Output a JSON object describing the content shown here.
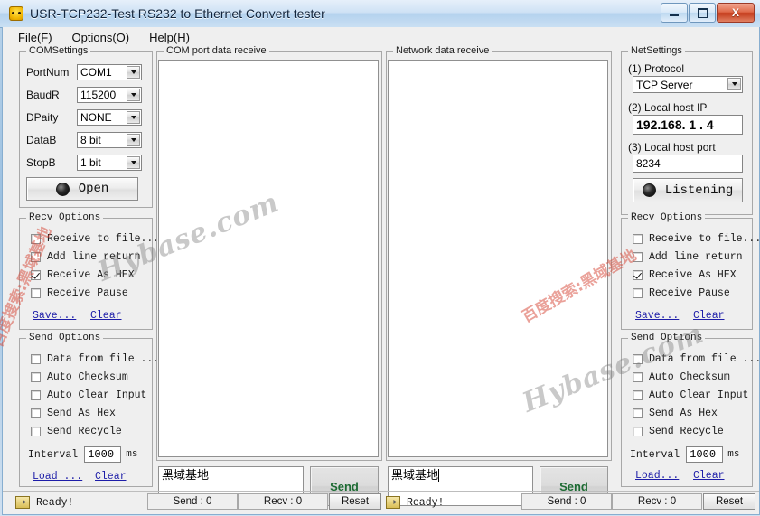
{
  "window": {
    "title": "USR-TCP232-Test  RS232 to Ethernet Convert tester",
    "icon": "app-icon",
    "minimize_label": "Minimize",
    "maximize_label": "Maximize",
    "close_label": "X"
  },
  "menu": [
    {
      "label": "File(F)",
      "name": "menu-file"
    },
    {
      "label": "Options(O)",
      "name": "menu-options"
    },
    {
      "label": "Help(H)",
      "name": "menu-help"
    }
  ],
  "com_settings": {
    "legend": "COMSettings",
    "fields": [
      {
        "label": "PortNum",
        "value": "COM1"
      },
      {
        "label": "BaudR",
        "value": "115200"
      },
      {
        "label": "DPaity",
        "value": "NONE"
      },
      {
        "label": "DataB",
        "value": "8 bit"
      },
      {
        "label": "StopB",
        "value": "1 bit"
      }
    ],
    "open_button": "Open"
  },
  "com_recv_options": {
    "legend": "Recv Options",
    "items": [
      {
        "label": "Receive to file...",
        "checked": false
      },
      {
        "label": "Add line return",
        "checked": false
      },
      {
        "label": "Receive As HEX",
        "checked": true
      },
      {
        "label": "Receive Pause",
        "checked": false
      }
    ],
    "save_link": "Save...",
    "clear_link": "Clear"
  },
  "com_send_options": {
    "legend": "Send Options",
    "items": [
      {
        "label": "Data from file ...",
        "checked": false
      },
      {
        "label": "Auto Checksum",
        "checked": false
      },
      {
        "label": "Auto Clear Input",
        "checked": false
      },
      {
        "label": "Send As Hex",
        "checked": false
      },
      {
        "label": "Send Recycle",
        "checked": false
      }
    ],
    "interval_label": "Interval",
    "interval_value": "1000",
    "interval_unit": "ms",
    "load_link": "Load ...",
    "clear_link": "Clear"
  },
  "com_receive_pane": {
    "legend": "COM port data receive",
    "content": ""
  },
  "net_receive_pane": {
    "legend": "Network data receive",
    "content": ""
  },
  "com_send": {
    "input_value": "黑域基地",
    "button_label": "Send"
  },
  "net_send": {
    "input_value": "黑域基地",
    "button_label": "Send"
  },
  "net_settings": {
    "legend": "NetSettings",
    "protocol_label": "(1) Protocol",
    "protocol_value": "TCP Server",
    "host_ip_label": "(2) Local host IP",
    "host_ip_value": "192.168. 1  . 4",
    "host_port_label": "(3) Local host port",
    "host_port_value": "8234",
    "listen_button": "Listening"
  },
  "net_recv_options": {
    "legend": "Recv Options",
    "items": [
      {
        "label": "Receive to file...",
        "checked": false
      },
      {
        "label": "Add line return",
        "checked": false
      },
      {
        "label": "Receive As HEX",
        "checked": true
      },
      {
        "label": "Receive Pause",
        "checked": false
      }
    ],
    "save_link": "Save...",
    "clear_link": "Clear"
  },
  "net_send_options": {
    "legend": "Send Options",
    "items": [
      {
        "label": "Data from file ...",
        "checked": false
      },
      {
        "label": "Auto Checksum",
        "checked": false
      },
      {
        "label": "Auto Clear Input",
        "checked": false
      },
      {
        "label": "Send As Hex",
        "checked": false
      },
      {
        "label": "Send Recycle",
        "checked": false
      }
    ],
    "interval_label": "Interval",
    "interval_value": "1000",
    "interval_unit": "ms",
    "load_link": "Load...",
    "clear_link": "Clear"
  },
  "com_status": {
    "ready": "Ready!",
    "send_count": "Send : 0",
    "recv_count": "Recv : 0",
    "reset": "Reset"
  },
  "net_status": {
    "ready": "Ready!",
    "send_count": "Send : 0",
    "recv_count": "Recv : 0",
    "reset": "Reset"
  },
  "watermarks": {
    "gray_left": "Hybase.com",
    "gray_right": "Hybase.com",
    "red_left": "百度搜索:黑域基地",
    "red_right": "百度搜索:黑域基地"
  }
}
